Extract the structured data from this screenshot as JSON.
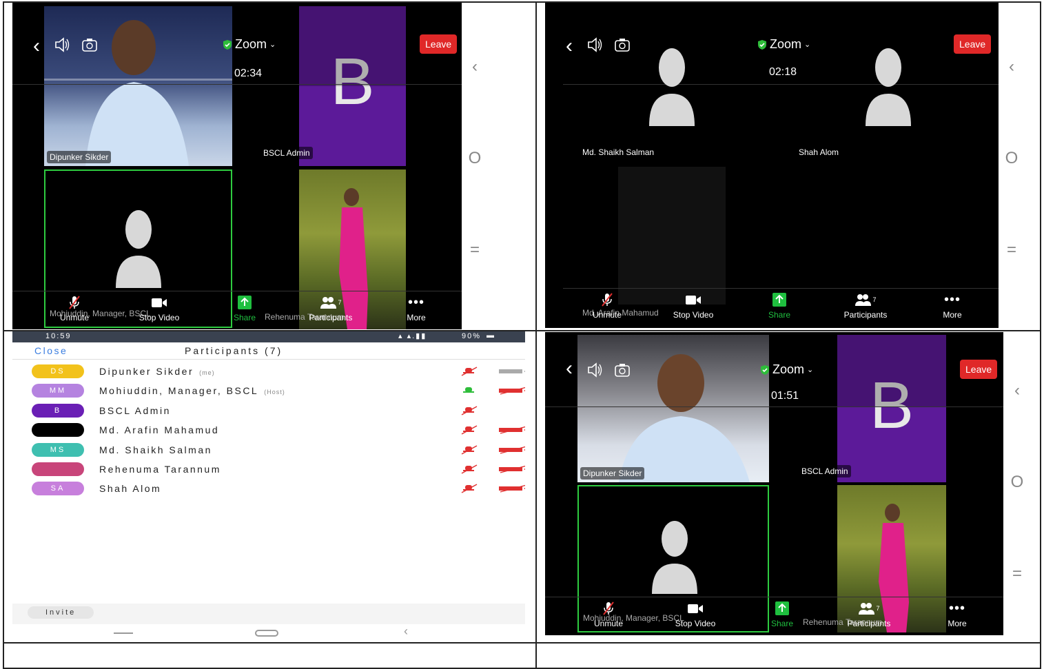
{
  "panels": {
    "tl": {
      "meeting_title": "Zoom",
      "timer": "02:34",
      "leave": "Leave",
      "tiles": {
        "dipunker": "Dipunker Sikder",
        "bscl_letter": "B",
        "bscl": "BSCL Admin",
        "mohiuddin": "Mohiuddin, Manager, BSCL",
        "rehenuma": "Rehenuma Tarannum"
      },
      "toolbar": {
        "unmute": "Unmute",
        "stop_video": "Stop Video",
        "share": "Share",
        "participants": "Participants",
        "participants_count": "7",
        "more": "More"
      },
      "nav": {
        "back": "‹",
        "home": "O",
        "menu": "="
      }
    },
    "tr": {
      "meeting_title": "Zoom",
      "timer": "02:18",
      "leave": "Leave",
      "tiles": {
        "salman": "Md. Shaikh Salman",
        "shah": "Shah Alom",
        "arafin": "Md. Arafin Mahamud"
      },
      "toolbar": {
        "unmute": "Unmute",
        "stop_video": "Stop Video",
        "share": "Share",
        "participants": "Participants",
        "participants_count": "7",
        "more": "More"
      },
      "nav": {
        "back": "‹",
        "home": "O",
        "menu": "="
      }
    },
    "bl": {
      "status_time": "10:59",
      "status_battery": "90%",
      "close": "Close",
      "title": "Participants (7)",
      "participants": [
        {
          "initials": "DS",
          "name": "Dipunker Sikder",
          "tag": "(me)",
          "color": "#f2c21b",
          "mic": "muted",
          "video": "on"
        },
        {
          "initials": "MM",
          "name": "Mohiuddin, Manager, BSCL",
          "tag": "(Host)",
          "color": "#b583e0",
          "mic": "on",
          "video": "off"
        },
        {
          "initials": "B",
          "name": "BSCL Admin",
          "tag": "",
          "color": "#6a1fb5",
          "mic": "muted",
          "video": "none"
        },
        {
          "initials": "",
          "name": "Md. Arafin Mahamud",
          "tag": "",
          "color": "#000000",
          "mic": "muted",
          "video": "off"
        },
        {
          "initials": "MS",
          "name": "Md. Shaikh Salman",
          "tag": "",
          "color": "#3fbfb0",
          "mic": "muted",
          "video": "off"
        },
        {
          "initials": "",
          "name": "Rehenuma Tarannum",
          "tag": "",
          "color": "#c8457a",
          "mic": "muted",
          "video": "off"
        },
        {
          "initials": "SA",
          "name": "Shah Alom",
          "tag": "",
          "color": "#c77fdc",
          "mic": "muted",
          "video": "off"
        }
      ],
      "invite": "Invite"
    },
    "br": {
      "meeting_title": "Zoom",
      "timer": "01:51",
      "leave": "Leave",
      "tiles": {
        "dipunker": "Dipunker Sikder",
        "bscl_letter": "B",
        "bscl": "BSCL Admin",
        "mohiuddin": "Mohiuddin, Manager, BSCL",
        "rehenuma": "Rehenuma Tarannum"
      },
      "toolbar": {
        "unmute": "Unmute",
        "stop_video": "Stop Video",
        "share": "Share",
        "participants": "Participants",
        "participants_count": "7",
        "more": "More"
      },
      "nav": {
        "back": "‹",
        "home": "O",
        "menu": "="
      }
    }
  },
  "colors": {
    "leave": "#e02828",
    "share": "#1fbf3f",
    "active_border": "#2ecc40",
    "bscl_purple": "#6a1fb5",
    "muted_red": "#e03030",
    "mic_green": "#2ebd3a"
  }
}
